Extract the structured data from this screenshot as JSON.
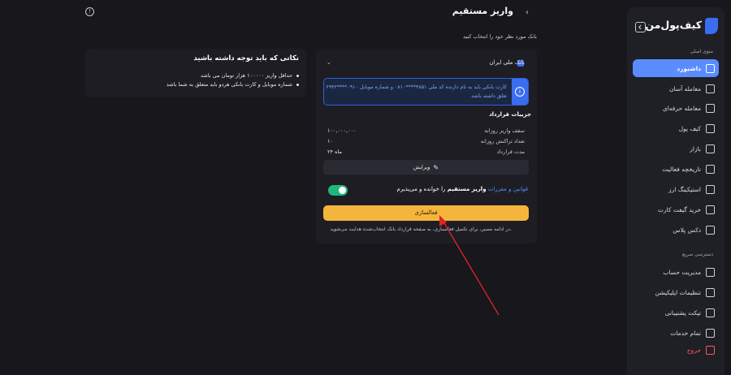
{
  "header": {
    "title": "واریز مستقیم",
    "subtitle": "بانک مورد نظر خود را انتخاب کنید"
  },
  "sidebar": {
    "brand": "کیف‌پول‌من",
    "main_menu_title": "منوی اصلی",
    "items": [
      {
        "label": "داشبورد"
      },
      {
        "label": "معامله آسان"
      },
      {
        "label": "معامله حرفه‌ای"
      },
      {
        "label": "کیف پول"
      },
      {
        "label": "بازار"
      },
      {
        "label": "تاریخچه فعالیت"
      },
      {
        "label": "استیکینگ ارز"
      },
      {
        "label": "خرید گیفت کارت"
      },
      {
        "label": "دکس پلاس"
      }
    ],
    "quick_access_title": "دسترسی سریع",
    "quick_items": [
      {
        "label": "مدیریت حساب"
      },
      {
        "label": "تنظیمات اپلیکیشن"
      },
      {
        "label": "تیکت پشتیبانی"
      },
      {
        "label": "تمام خدمات"
      },
      {
        "label": "خروج"
      }
    ]
  },
  "bank": {
    "name": "بانک ملی ایران",
    "info": "کارت بانکی باید به نام دارنده کد ملی ۴۸۵۱****۰۸۱۰ و شماره موبایل ۰۹۱۰****۶۹۴۲ تعلق داشته باشد."
  },
  "details": {
    "title": "جزییات قرارداد",
    "rows": [
      {
        "label": "سقف واریز روزانه",
        "value": "۱۰۰,۰۰۰,۰۰۰"
      },
      {
        "label": "تعداد تراکنش روزانه",
        "value": "۱۰"
      },
      {
        "label": "مدت قرارداد",
        "value": "۲۴ ماه"
      }
    ],
    "edit_label": "ویرایش"
  },
  "terms": {
    "link": "قوانین و مقررات",
    "bold": "واریز مستقیم",
    "rest": "را خوانده و می‌پذیرم",
    "accepted": true
  },
  "activate_label": "فعالسازی",
  "note": "در ادامه مسیر، برای تکمیل فعالسازی، به صفحه قرارداد بانک انتخاب‌شده هدایت می‌شوید.",
  "tips": {
    "title": "نکاتی که باید توجه داشته باشید",
    "items": [
      "حداقل واریز ۱۰۰۰۰۰ هزار تومان می باشد",
      "شماره موبایل و کارت بانکی هردو باید متعلق به شما باشد"
    ]
  },
  "colors": {
    "accent": "#5b8cff",
    "primary_button": "#f5b53c",
    "toggle_on": "#1fb87a",
    "annotation_arrow": "#e02424"
  }
}
